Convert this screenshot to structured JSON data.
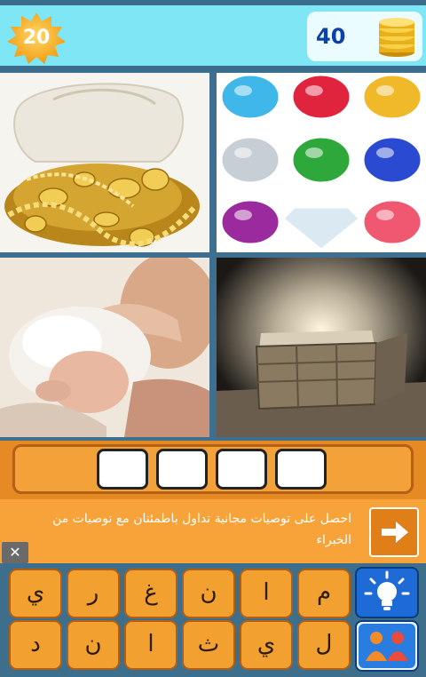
{
  "header": {
    "level": "20",
    "coins": "40",
    "icons": {
      "level_badge": "sun-star-badge",
      "coins": "gold-coin-stack"
    }
  },
  "tiles": [
    {
      "name": "gold-jewelry-bag",
      "icon": "photo"
    },
    {
      "name": "gemstones",
      "icon": "photo"
    },
    {
      "name": "newborn-baby",
      "icon": "photo"
    },
    {
      "name": "treasure-chest",
      "icon": "photo"
    }
  ],
  "answer": {
    "slots": [
      "",
      "",
      "",
      ""
    ]
  },
  "ad": {
    "text": "احصل على توصيات مجانية تداول باطمئنان مع توصيات من الخبراء",
    "close": "✕",
    "arrow_icon": "arrow-right-icon"
  },
  "keyboard": {
    "row1": [
      "ي",
      "ر",
      "غ",
      "ن",
      "ا",
      "م"
    ],
    "row2": [
      "د",
      "ن",
      "ا",
      "ث",
      "ي",
      "ل"
    ],
    "tools": {
      "hint": "lightbulb-icon",
      "share": "people-icon"
    }
  },
  "colors": {
    "cyan": "#7ee6f4",
    "orange": "#f2a131",
    "navy": "#0d3fa8",
    "frame": "#3f6f8e"
  }
}
